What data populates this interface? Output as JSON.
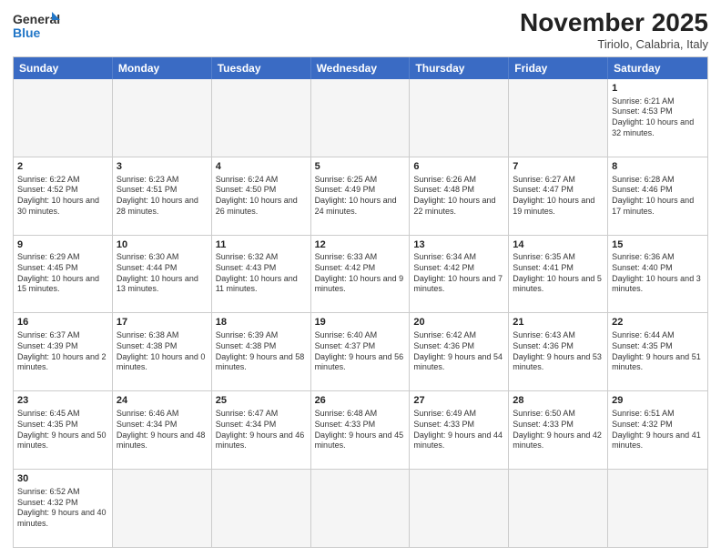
{
  "header": {
    "logo_general": "General",
    "logo_blue": "Blue",
    "month_title": "November 2025",
    "subtitle": "Tiriolo, Calabria, Italy"
  },
  "days_of_week": [
    "Sunday",
    "Monday",
    "Tuesday",
    "Wednesday",
    "Thursday",
    "Friday",
    "Saturday"
  ],
  "rows": [
    [
      {
        "day": "",
        "info": ""
      },
      {
        "day": "",
        "info": ""
      },
      {
        "day": "",
        "info": ""
      },
      {
        "day": "",
        "info": ""
      },
      {
        "day": "",
        "info": ""
      },
      {
        "day": "",
        "info": ""
      },
      {
        "day": "1",
        "info": "Sunrise: 6:21 AM\nSunset: 4:53 PM\nDaylight: 10 hours and 32 minutes."
      }
    ],
    [
      {
        "day": "2",
        "info": "Sunrise: 6:22 AM\nSunset: 4:52 PM\nDaylight: 10 hours and 30 minutes."
      },
      {
        "day": "3",
        "info": "Sunrise: 6:23 AM\nSunset: 4:51 PM\nDaylight: 10 hours and 28 minutes."
      },
      {
        "day": "4",
        "info": "Sunrise: 6:24 AM\nSunset: 4:50 PM\nDaylight: 10 hours and 26 minutes."
      },
      {
        "day": "5",
        "info": "Sunrise: 6:25 AM\nSunset: 4:49 PM\nDaylight: 10 hours and 24 minutes."
      },
      {
        "day": "6",
        "info": "Sunrise: 6:26 AM\nSunset: 4:48 PM\nDaylight: 10 hours and 22 minutes."
      },
      {
        "day": "7",
        "info": "Sunrise: 6:27 AM\nSunset: 4:47 PM\nDaylight: 10 hours and 19 minutes."
      },
      {
        "day": "8",
        "info": "Sunrise: 6:28 AM\nSunset: 4:46 PM\nDaylight: 10 hours and 17 minutes."
      }
    ],
    [
      {
        "day": "9",
        "info": "Sunrise: 6:29 AM\nSunset: 4:45 PM\nDaylight: 10 hours and 15 minutes."
      },
      {
        "day": "10",
        "info": "Sunrise: 6:30 AM\nSunset: 4:44 PM\nDaylight: 10 hours and 13 minutes."
      },
      {
        "day": "11",
        "info": "Sunrise: 6:32 AM\nSunset: 4:43 PM\nDaylight: 10 hours and 11 minutes."
      },
      {
        "day": "12",
        "info": "Sunrise: 6:33 AM\nSunset: 4:42 PM\nDaylight: 10 hours and 9 minutes."
      },
      {
        "day": "13",
        "info": "Sunrise: 6:34 AM\nSunset: 4:42 PM\nDaylight: 10 hours and 7 minutes."
      },
      {
        "day": "14",
        "info": "Sunrise: 6:35 AM\nSunset: 4:41 PM\nDaylight: 10 hours and 5 minutes."
      },
      {
        "day": "15",
        "info": "Sunrise: 6:36 AM\nSunset: 4:40 PM\nDaylight: 10 hours and 3 minutes."
      }
    ],
    [
      {
        "day": "16",
        "info": "Sunrise: 6:37 AM\nSunset: 4:39 PM\nDaylight: 10 hours and 2 minutes."
      },
      {
        "day": "17",
        "info": "Sunrise: 6:38 AM\nSunset: 4:38 PM\nDaylight: 10 hours and 0 minutes."
      },
      {
        "day": "18",
        "info": "Sunrise: 6:39 AM\nSunset: 4:38 PM\nDaylight: 9 hours and 58 minutes."
      },
      {
        "day": "19",
        "info": "Sunrise: 6:40 AM\nSunset: 4:37 PM\nDaylight: 9 hours and 56 minutes."
      },
      {
        "day": "20",
        "info": "Sunrise: 6:42 AM\nSunset: 4:36 PM\nDaylight: 9 hours and 54 minutes."
      },
      {
        "day": "21",
        "info": "Sunrise: 6:43 AM\nSunset: 4:36 PM\nDaylight: 9 hours and 53 minutes."
      },
      {
        "day": "22",
        "info": "Sunrise: 6:44 AM\nSunset: 4:35 PM\nDaylight: 9 hours and 51 minutes."
      }
    ],
    [
      {
        "day": "23",
        "info": "Sunrise: 6:45 AM\nSunset: 4:35 PM\nDaylight: 9 hours and 50 minutes."
      },
      {
        "day": "24",
        "info": "Sunrise: 6:46 AM\nSunset: 4:34 PM\nDaylight: 9 hours and 48 minutes."
      },
      {
        "day": "25",
        "info": "Sunrise: 6:47 AM\nSunset: 4:34 PM\nDaylight: 9 hours and 46 minutes."
      },
      {
        "day": "26",
        "info": "Sunrise: 6:48 AM\nSunset: 4:33 PM\nDaylight: 9 hours and 45 minutes."
      },
      {
        "day": "27",
        "info": "Sunrise: 6:49 AM\nSunset: 4:33 PM\nDaylight: 9 hours and 44 minutes."
      },
      {
        "day": "28",
        "info": "Sunrise: 6:50 AM\nSunset: 4:33 PM\nDaylight: 9 hours and 42 minutes."
      },
      {
        "day": "29",
        "info": "Sunrise: 6:51 AM\nSunset: 4:32 PM\nDaylight: 9 hours and 41 minutes."
      }
    ],
    [
      {
        "day": "30",
        "info": "Sunrise: 6:52 AM\nSunset: 4:32 PM\nDaylight: 9 hours and 40 minutes."
      },
      {
        "day": "",
        "info": ""
      },
      {
        "day": "",
        "info": ""
      },
      {
        "day": "",
        "info": ""
      },
      {
        "day": "",
        "info": ""
      },
      {
        "day": "",
        "info": ""
      },
      {
        "day": "",
        "info": ""
      }
    ]
  ]
}
